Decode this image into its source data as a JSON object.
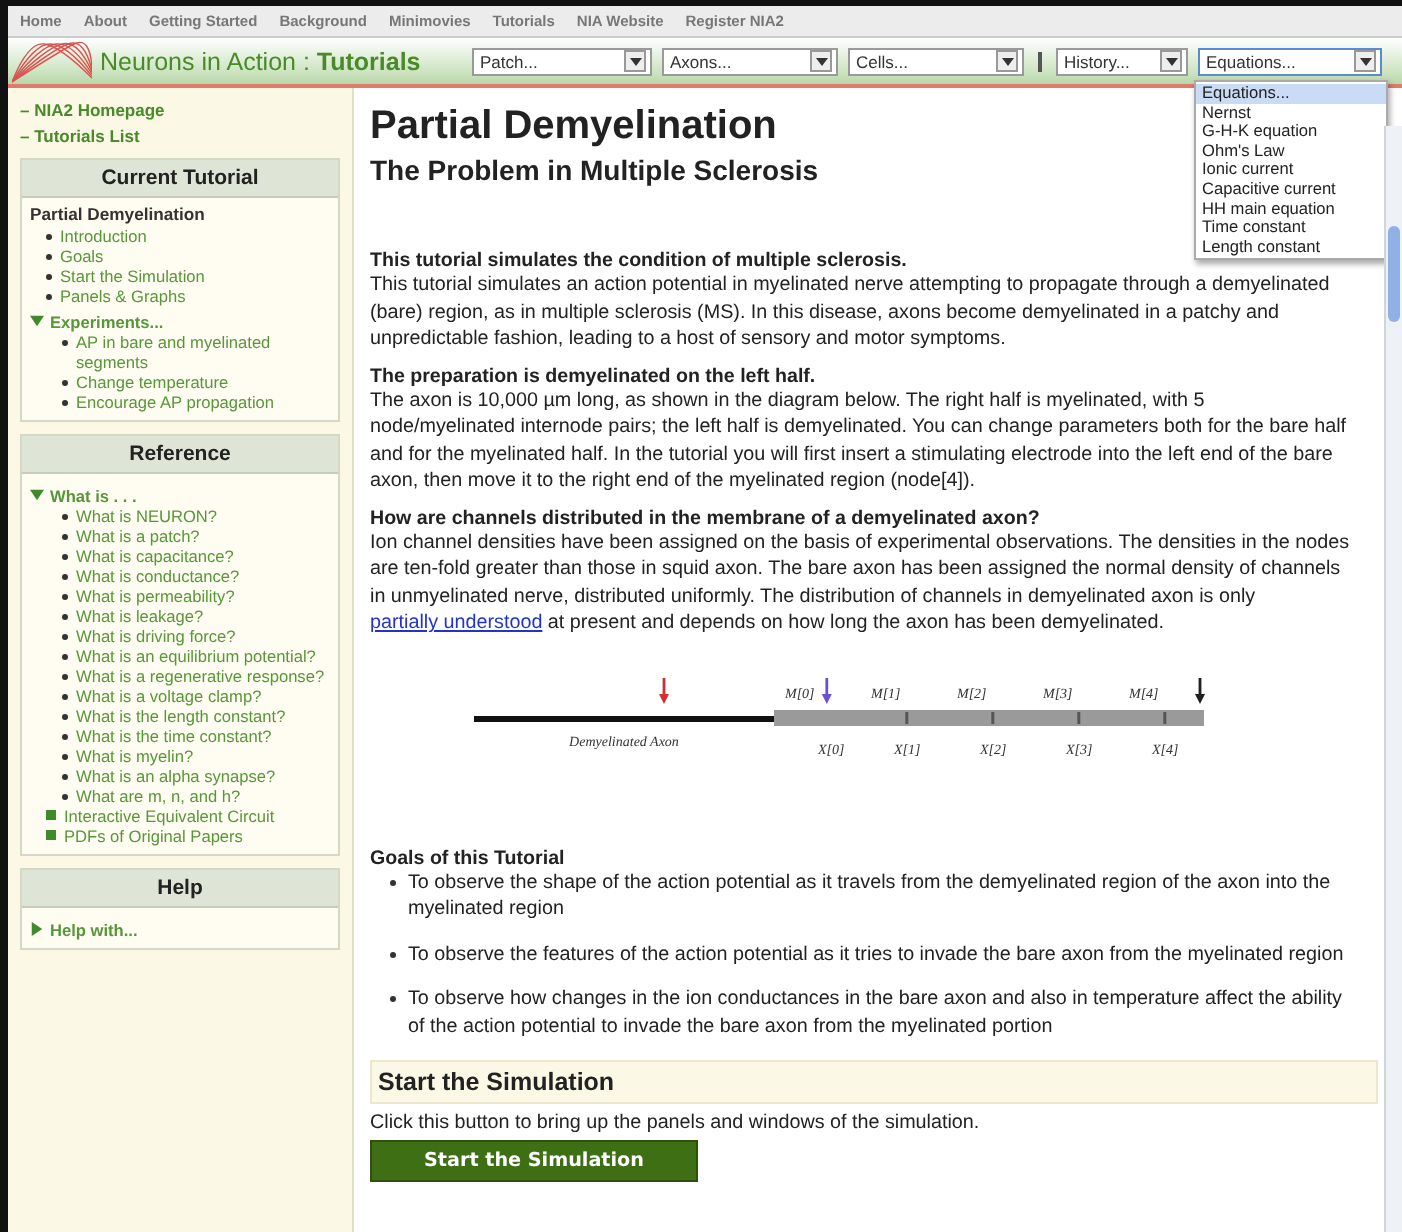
{
  "nav": {
    "items": [
      "Home",
      "About",
      "Getting Started",
      "Background",
      "Minimovies",
      "Tutorials",
      "NIA Website",
      "Register NIA2"
    ]
  },
  "header": {
    "site": "Neurons in Action :",
    "section": "Tutorials",
    "menus": [
      {
        "label": "Patch...",
        "expanded": false
      },
      {
        "label": "Axons...",
        "expanded": false
      },
      {
        "label": "Cells...",
        "expanded": false
      },
      {
        "label": "History...",
        "expanded": false
      },
      {
        "label": "Equations...",
        "expanded": true
      }
    ],
    "open_menu": [
      {
        "label": "Equations...",
        "selected": true
      },
      {
        "label": "Nernst",
        "selected": false
      },
      {
        "label": "G-H-K equation",
        "selected": false
      },
      {
        "label": "Ohm's Law",
        "selected": false
      },
      {
        "label": "Ionic current",
        "selected": false
      },
      {
        "label": "Capacitive current",
        "selected": false
      },
      {
        "label": "HH main equation",
        "selected": false
      },
      {
        "label": "Time constant",
        "selected": false
      },
      {
        "label": "Length constant",
        "selected": false
      }
    ]
  },
  "sidebar": {
    "links": [
      "– NIA2 Homepage",
      "– Tutorials List"
    ],
    "panels": [
      {
        "title": "Current Tutorial",
        "items": [
          {
            "kind": "heading",
            "label": "Partial Demyelination"
          },
          {
            "kind": "bullet",
            "label": "Introduction"
          },
          {
            "kind": "bullet",
            "label": "Goals"
          },
          {
            "kind": "bullet",
            "label": "Start the Simulation"
          },
          {
            "kind": "bullet",
            "label": "Panels & Graphs"
          },
          {
            "kind": "toggle",
            "label": "Experiments...",
            "expanded": true,
            "children": [
              {
                "kind": "bullet",
                "label": "AP in bare and myelinated segments"
              },
              {
                "kind": "bullet",
                "label": "Change temperature"
              },
              {
                "kind": "bullet",
                "label": "Encourage AP propagation"
              }
            ]
          }
        ]
      },
      {
        "title": "Reference",
        "items": [
          {
            "kind": "toggle",
            "label": "What is . . .",
            "expanded": true,
            "children": [
              {
                "kind": "bullet",
                "label": "What is NEURON?"
              },
              {
                "kind": "bullet",
                "label": "What is a patch?"
              },
              {
                "kind": "bullet",
                "label": "What is capacitance?"
              },
              {
                "kind": "bullet",
                "label": "What is conductance?"
              },
              {
                "kind": "bullet",
                "label": "What is permeability?"
              },
              {
                "kind": "bullet",
                "label": "What is leakage?"
              },
              {
                "kind": "bullet",
                "label": "What is driving force?"
              },
              {
                "kind": "bullet",
                "label": "What is an equilibrium potential?"
              },
              {
                "kind": "bullet",
                "label": "What is a regenerative response?"
              },
              {
                "kind": "bullet",
                "label": "What is a voltage clamp?"
              },
              {
                "kind": "bullet",
                "label": "What is the length constant?"
              },
              {
                "kind": "bullet",
                "label": "What is the time constant?"
              },
              {
                "kind": "bullet",
                "label": "What is myelin?"
              },
              {
                "kind": "bullet",
                "label": "What is an alpha synapse?"
              },
              {
                "kind": "bullet",
                "label": "What are m, n, and h?"
              }
            ]
          },
          {
            "kind": "square",
            "label": "Interactive Equivalent Circuit"
          },
          {
            "kind": "square",
            "label": "PDFs of Original Papers"
          }
        ]
      },
      {
        "title": "Help",
        "items": [
          {
            "kind": "toggle",
            "label": "Help with...",
            "expanded": false
          }
        ]
      }
    ]
  },
  "main": {
    "title": "Partial Demyelination",
    "subtitle": "The Problem in Multiple Sclerosis",
    "sections": [
      {
        "heading": "This tutorial simulates the condition of multiple sclerosis.",
        "text": "This tutorial simulates an action potential in myelinated nerve attempting to propagate through a demyelinated (bare) region, as in multiple sclerosis (MS). In this disease, axons become demyelinated in a patchy and unpredictable fashion, leading to a host of sensory and motor symptoms."
      },
      {
        "heading": "The preparation is demyelinated on the left half.",
        "text": "The axon is 10,000 µm long, as shown in the diagram below. The right half is myelinated, with 5 node/myelinated internode pairs; the left half is demyelinated. You can change parameters both for the bare half and for the myelinated half. In the tutorial you will first insert a stimulating electrode into the left end of the bare axon, then move it to the right end of the myelinated region (node[4])."
      },
      {
        "heading": "How are channels distributed in the membrane of a demyelinated axon?",
        "text": "Ion channel densities have been assigned on the basis of experimental observations. The densities in the nodes are ten-fold greater than those in squid axon. The bare axon has been assigned the normal density of channels in unmyelinated nerve, distributed uniformly. The distribution of channels in demyelinated axon is only ",
        "link": "partially understood",
        "text_after": " at present and depends on how long the axon has been demyelinated."
      }
    ],
    "diagram": {
      "axon_label": "Demyelinated Axon",
      "segments": [
        {
          "top": "M[0]",
          "bottom": "X[0]"
        },
        {
          "top": "M[1]",
          "bottom": "X[1]"
        },
        {
          "top": "M[2]",
          "bottom": "X[2]"
        },
        {
          "top": "M[3]",
          "bottom": "X[3]"
        },
        {
          "top": "M[4]",
          "bottom": "X[4]"
        }
      ],
      "electrodes": [
        {
          "color": "#d03030"
        },
        {
          "color": "#6a50d8"
        },
        {
          "color": "#202020"
        }
      ]
    },
    "goals": {
      "heading": "Goals of this Tutorial",
      "items": [
        "To observe the shape of the action potential as it travels from the demyelinated region of the axon into the myelinated region",
        "To observe the features of the action potential as it tries to invade the bare axon from the myelinated region",
        "To observe how changes in the ion conductances in the bare axon and also in temperature affect the ability of the action potential to invade the bare axon from the myelinated portion"
      ]
    },
    "start": {
      "heading": "Start the Simulation",
      "text": "Click this button to bring up the panels and windows of the simulation.",
      "button": "Start the Simulation"
    }
  }
}
